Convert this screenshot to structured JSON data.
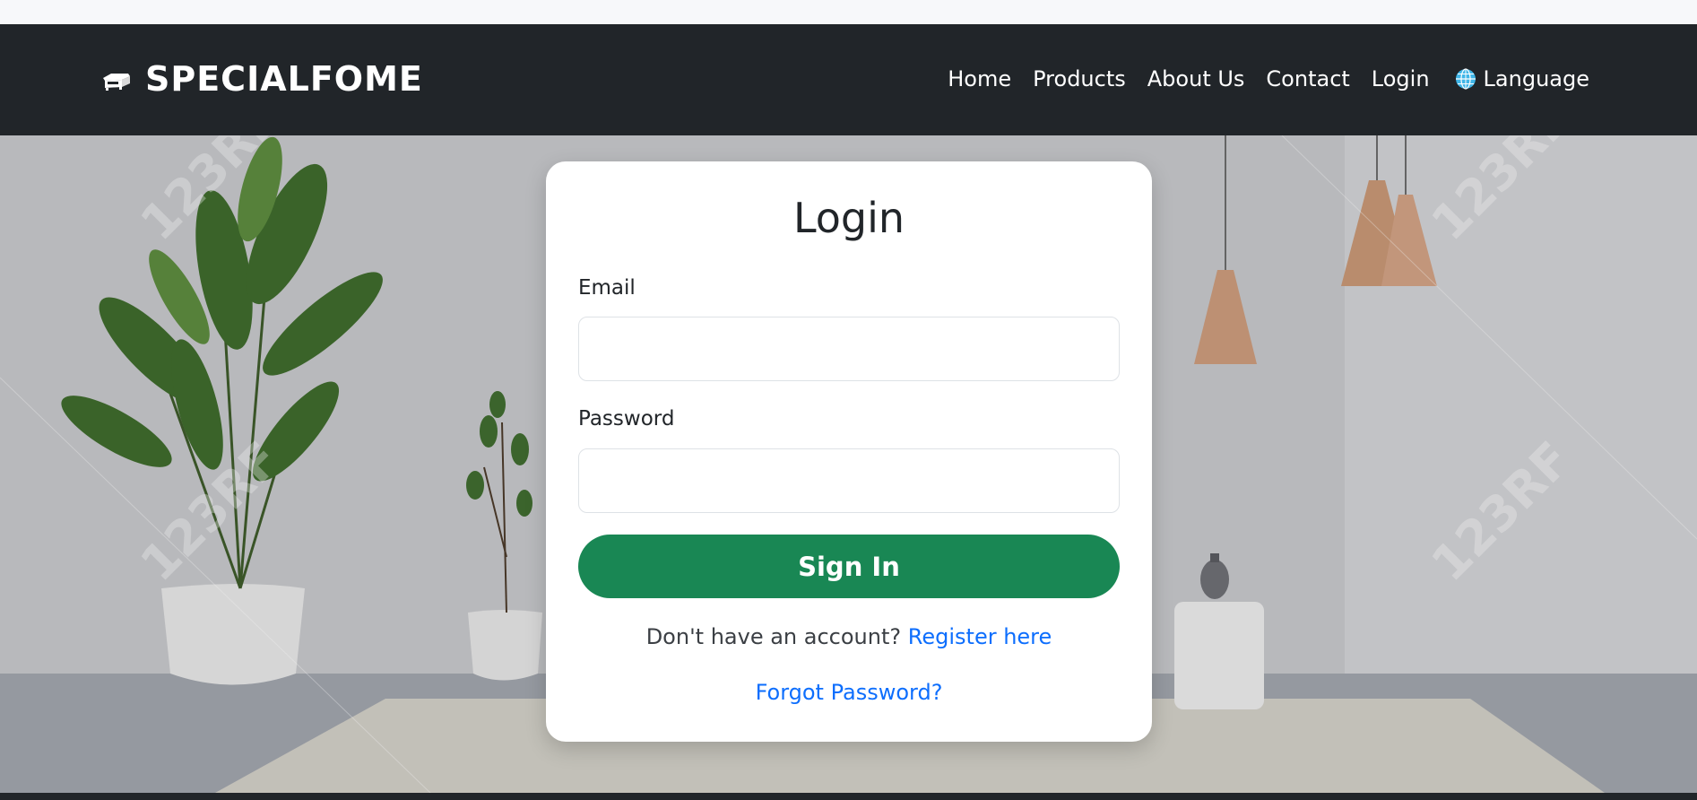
{
  "brand": {
    "name": "SPECIALFOME",
    "icon": "sofa-icon"
  },
  "nav": {
    "items": [
      "Home",
      "Products",
      "About Us",
      "Contact",
      "Login"
    ],
    "language_label": "Language",
    "language_icon": "globe-icon"
  },
  "login": {
    "title": "Login",
    "email_label": "Email",
    "email_value": "",
    "password_label": "Password",
    "password_value": "",
    "submit_label": "Sign In",
    "register_prompt": "Don't have an account?",
    "register_link": "Register here",
    "forgot_link": "Forgot Password?"
  },
  "hero": {
    "watermark": "123RF"
  },
  "colors": {
    "navbar": "#212529",
    "primary_button": "#198754",
    "link": "#0d6efd",
    "card": "#ffffff"
  }
}
